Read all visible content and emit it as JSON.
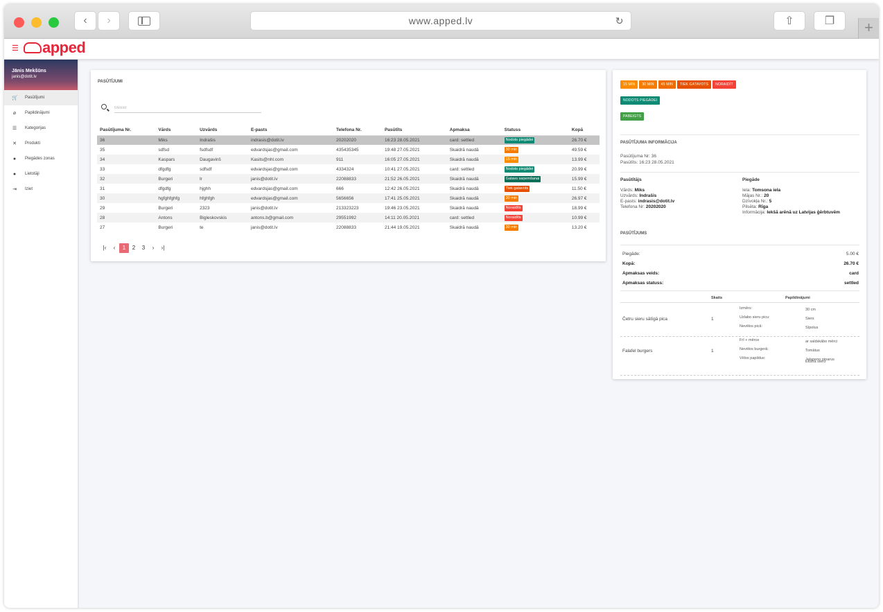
{
  "browser": {
    "url": "www.apped.lv"
  },
  "app": {
    "logo_text": "apped"
  },
  "user": {
    "name": "Jānis Mekšūns",
    "email": "janis@dotit.lv"
  },
  "nav": [
    {
      "icon": "cart-icon",
      "glyph": "🛒",
      "label": "Pasūtījumi",
      "active": true
    },
    {
      "icon": "paperclip-icon",
      "glyph": "⌀",
      "label": "Papildinājumi",
      "active": false
    },
    {
      "icon": "list-icon",
      "glyph": "☰",
      "label": "Kategorijas",
      "active": false
    },
    {
      "icon": "utensils-icon",
      "glyph": "✕",
      "label": "Produkti",
      "active": false
    },
    {
      "icon": "pin-icon",
      "glyph": "●",
      "label": "Piegādes zonas",
      "active": false
    },
    {
      "icon": "user-icon",
      "glyph": "●",
      "label": "Lietotāji",
      "active": false
    },
    {
      "icon": "logout-icon",
      "glyph": "⇥",
      "label": "Iziet",
      "active": false
    }
  ],
  "orders": {
    "title": "PASŪTĪJUMI",
    "search_placeholder": "Meklēt",
    "columns": [
      "Pasūtījuma Nr.",
      "Vārds",
      "Uzvārds",
      "E-pasts",
      "Telefona Nr.",
      "Pasūtīts",
      "Apmaksa",
      "Statuss",
      "Kopā"
    ],
    "rows": [
      {
        "nr": "36",
        "name": "Miks",
        "surname": "Indrašis",
        "email": "indrasis@dotit.lv",
        "phone": "20202020",
        "ordered": "16:23 28.05.2021",
        "payment": "card: settled",
        "status": "Nodots piegādei",
        "status_color": "#0d8a73",
        "total": "26.70 €"
      },
      {
        "nr": "35",
        "name": "sdfsd",
        "surname": "fsdfsdf",
        "email": "edvardsjas@gmail.com",
        "phone": "435435345",
        "ordered": "19:48 27.05.2021",
        "payment": "Skaidrā naudā",
        "status": "30 min",
        "status_color": "#f57c00",
        "total": "49.59 €"
      },
      {
        "nr": "34",
        "name": "Kaspars",
        "surname": "Daugavinš",
        "email": "Kasits@nhl.com",
        "phone": "911",
        "ordered": "16:05 27.05.2021",
        "payment": "Skaidrā naudā",
        "status": "15 min",
        "status_color": "#fb8c00",
        "total": "13.99 €"
      },
      {
        "nr": "33",
        "name": "dfgdfg",
        "surname": "sdfsdf",
        "email": "edvardsjas@gmail.com",
        "phone": "4334324",
        "ordered": "10:41 27.05.2021",
        "payment": "card: settled",
        "status": "Nodots piegādei",
        "status_color": "#0d8a73",
        "total": "20.99 €"
      },
      {
        "nr": "32",
        "name": "Burgeri",
        "surname": "lr",
        "email": "janis@dotit.lv",
        "phone": "22088833",
        "ordered": "21:52 26.05.2021",
        "payment": "Skaidrā naudā",
        "status": "Gatavs saņemšanai",
        "status_color": "#0b6e58",
        "total": "15.99 €"
      },
      {
        "nr": "31",
        "name": "dfgdfg",
        "surname": "hjghh",
        "email": "edvardsjas@gmail.com",
        "phone": "666",
        "ordered": "12:42 26.05.2021",
        "payment": "Skaidrā naudā",
        "status": "Tiek gatavots",
        "status_color": "#e65100",
        "total": "11.50 €"
      },
      {
        "nr": "30",
        "name": "hgfghfghfg",
        "surname": "hfghfgh",
        "email": "edvardsjas@gmail.com",
        "phone": "5656656",
        "ordered": "17:41 25.05.2021",
        "payment": "Skaidrā naudā",
        "status": "30 min",
        "status_color": "#f57c00",
        "total": "26.97 €"
      },
      {
        "nr": "29",
        "name": "Burgeri",
        "surname": "2323",
        "email": "janis@dotit.lv",
        "phone": "213323223",
        "ordered": "19:46 23.05.2021",
        "payment": "Skaidrā naudā",
        "status": "Noraidīts",
        "status_color": "#f44336",
        "total": "18.99 €"
      },
      {
        "nr": "28",
        "name": "Antons",
        "surname": "Bigleskovskis",
        "email": "antons.b@gmail.com",
        "phone": "29551992",
        "ordered": "14:11 20.05.2021",
        "payment": "card: settled",
        "status": "Noraidīts",
        "status_color": "#f44336",
        "total": "10.99 €"
      },
      {
        "nr": "27",
        "name": "Burgeri",
        "surname": "te",
        "email": "janis@dotit.lv",
        "phone": "22088833",
        "ordered": "21:44 19.05.2021",
        "payment": "Skaidrā naudā",
        "status": "30 min",
        "status_color": "#f57c00",
        "total": "13.20 €"
      }
    ],
    "pager": {
      "first": "|‹",
      "prev": "‹",
      "pages": [
        "1",
        "2",
        "3"
      ],
      "current": "1",
      "next": "›",
      "last": "›|"
    }
  },
  "detail": {
    "status_buttons_row1": [
      {
        "label": "15 min",
        "color": "#fb8c00"
      },
      {
        "label": "30 min",
        "color": "#f57c00"
      },
      {
        "label": "45 min",
        "color": "#ef6c00"
      },
      {
        "label": "Tiek gatavots",
        "color": "#e65100"
      },
      {
        "label": "Noraidīt",
        "color": "#f44336"
      }
    ],
    "status_button_delivered": {
      "label": "Nodots piegādei",
      "color": "#0d8a73"
    },
    "status_button_done": {
      "label": "Pabeigts",
      "color": "#43a047"
    },
    "info_title": "PASŪTĪJUMA INFORMĀCIJA",
    "order_nr": "Pasūtījuma Nr: 36",
    "ordered_at": "Pasūtīts: 16:23 28.05.2021",
    "customer": {
      "title": "Pasūtītājs",
      "first_name_label": "Vārds:",
      "first_name": "Miks",
      "last_name_label": "Uzvārds:",
      "last_name": "Indrašis",
      "email_label": "E-pasts:",
      "email": "indrasis@dotit.lv",
      "phone_label": "Telefona Nr:",
      "phone": "20202020"
    },
    "delivery": {
      "title": "Piegāde",
      "street_label": "Iela:",
      "street": "Tomsona iela",
      "house_label": "Mājas Nr.:",
      "house": "20",
      "apt_label": "Dzīvokļa Nr.:",
      "apt": "5",
      "city_label": "Pilsēta:",
      "city": "Rīga",
      "info_label": "Informācija:",
      "info": "Iekšā arēnā uz Latvijas ģērbtuvēm"
    },
    "order_title": "PASŪTĪJUMS",
    "summary": [
      {
        "label": "Piegāde:",
        "value": "5.00 €",
        "bold": false
      },
      {
        "label": "Kopā:",
        "value": "26.70 €",
        "bold": true
      },
      {
        "label": "Apmaksas veids:",
        "value": "card",
        "bold": true
      },
      {
        "label": "Apmaksas statuss:",
        "value": "settled",
        "bold": true
      }
    ],
    "items_head": {
      "qty": "Skaits",
      "addons": "Papildinājumi"
    },
    "items": [
      {
        "name": "Četru sieru sātīgā pica",
        "qty": "1",
        "addons": [
          {
            "label": "Izmērs:",
            "value": "30 cm"
          },
          {
            "label": "Uzlabo sieru picu:",
            "value": "Siers"
          },
          {
            "label": "Nevēlos picā:",
            "value": "Sīpolus"
          }
        ]
      },
      {
        "name": "Falafel burgers",
        "qty": "1",
        "addons": [
          {
            "label": "Frī + mērce",
            "value": "ar saldskābo mērci"
          },
          {
            "label": "Nevēlos burgerā:",
            "value": "Tomātus"
          },
          {
            "label": "Vēlos papildus:",
            "value": "Jalapeno piparus"
          },
          {
            "label": "",
            "value": "Ekstra sieru"
          }
        ]
      }
    ]
  }
}
